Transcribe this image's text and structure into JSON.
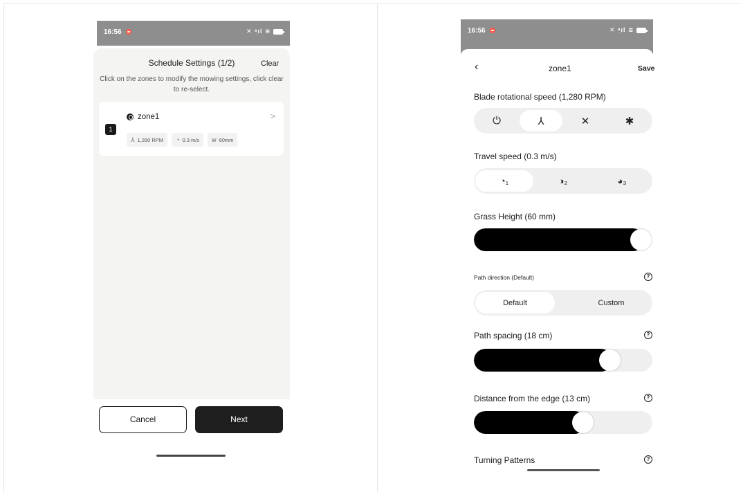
{
  "status": {
    "time": "16:56",
    "icons": "✕ ᵊ᷊ıl ≋",
    "battery": "5"
  },
  "left": {
    "title": "Schedule Settings (1/2)",
    "clear": "Clear",
    "hint": "Click on the zones to modify the mowing settings, click clear to re-select.",
    "zone": {
      "badge": "1",
      "name": "zone1",
      "chevron": ">",
      "chips": [
        {
          "icon": "blade-icon",
          "glyph": "⅄",
          "text": "1,280 RPM"
        },
        {
          "icon": "speed-icon",
          "glyph": "◔",
          "text": "0.3 m/s"
        },
        {
          "icon": "grass-icon",
          "glyph": "ᴡ",
          "text": "60mm"
        }
      ]
    },
    "cancel": "Cancel",
    "next": "Next"
  },
  "right": {
    "back": "‹",
    "title": "zone1",
    "save": "Save",
    "blade_label": "Blade rotational speed (1,280 RPM)",
    "blade_options": [
      {
        "icon": "power-icon",
        "glyph": "⏻",
        "selected": false
      },
      {
        "icon": "blade-3-icon",
        "glyph": "⅄",
        "selected": true
      },
      {
        "icon": "blade-4-icon",
        "glyph": "✕",
        "selected": false
      },
      {
        "icon": "blade-5-icon",
        "glyph": "✱",
        "selected": false
      }
    ],
    "travel_label": "Travel speed (0.3 m/s)",
    "travel_options": [
      {
        "icon": "speed-1-icon",
        "glyph": "◔₁",
        "selected": true
      },
      {
        "icon": "speed-2-icon",
        "glyph": "◑₂",
        "selected": false
      },
      {
        "icon": "speed-3-icon",
        "glyph": "◕₃",
        "selected": false
      }
    ],
    "grass_label": "Grass Height (60 mm)",
    "grass_level": 1.0,
    "path_dir_label": "Path direction (Default)",
    "path_dir_options": [
      {
        "label": "Default",
        "selected": true
      },
      {
        "label": "Custom",
        "selected": false
      }
    ],
    "spacing_label": "Path spacing (18 cm)",
    "spacing_level": 0.8,
    "edge_label": "Distance from the edge (13 cm)",
    "edge_level": 0.63,
    "turning_label": "Turning Patterns",
    "help_glyph": "?"
  }
}
